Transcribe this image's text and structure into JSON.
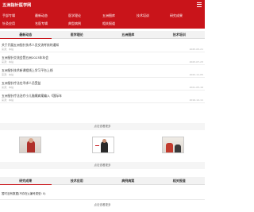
{
  "header": {
    "title": "五洲指针医学网"
  },
  "nav": {
    "row1": [
      "手部专辑",
      "最新动态",
      "医学理论",
      "五洲图库",
      "技术培训",
      "研究成果"
    ],
    "row2": [
      "针灸应用",
      "名医专辑",
      "典型病例",
      "相关报道"
    ]
  },
  "tabs": [
    "最新动态",
    "医学理论",
    "五洲图库",
    "技术培训"
  ],
  "news": [
    {
      "title": "关于开展五洲指针技术人员交流考核的通知",
      "meta": "来源：本站",
      "date": "2025-05-21"
    },
    {
      "title": "五洲指针交流会暨五洲2023年年会",
      "meta": "来源：本站",
      "date": "2023-07-23"
    },
    {
      "title": "五洲指针技术新课程线上学习平台上线",
      "meta": "来源：本站",
      "date": "2022-11-05"
    },
    {
      "title": "五洲指针疗法在寻求人员受益",
      "meta": "来源：本站",
      "date": "2021-05-16"
    },
    {
      "title": "五洲指针疗法治疗小儿脑瘫病案编入《国际年",
      "meta": "来源：本站",
      "date": "2019-12-11"
    }
  ],
  "more1": "点击查看更多",
  "more2": "点击查看更多",
  "more3": "点击查看更多",
  "lower_tabs": [
    "研究成果",
    "技术应用",
    "病例病案",
    "相关报道"
  ],
  "empty_text": "暂时没有数据(不存在)(编号类型: 0)",
  "colors": {
    "brand": "#c9141a"
  }
}
